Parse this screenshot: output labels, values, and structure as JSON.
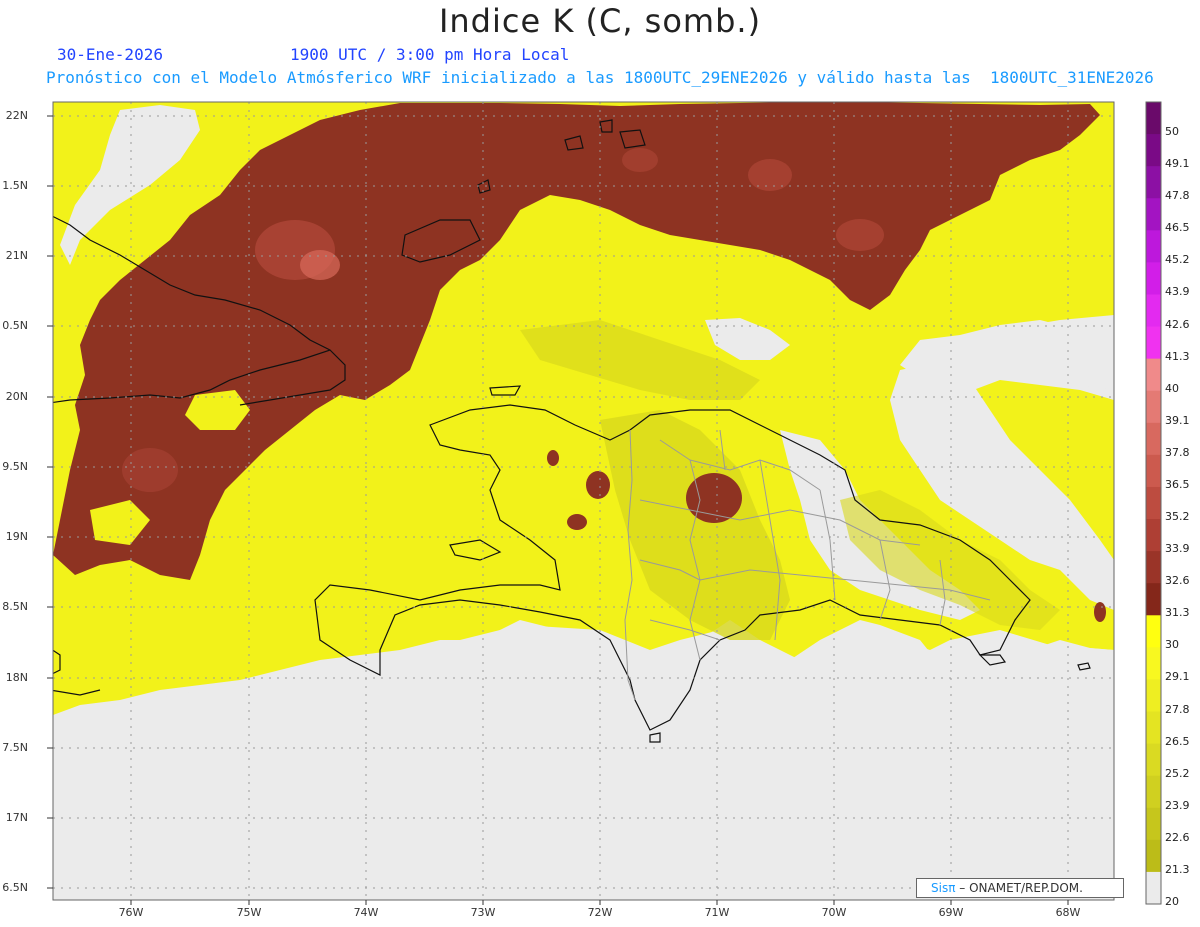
{
  "title": "Indice K (C, somb.)",
  "date": "30-Ene-2026",
  "valid_time": "1900 UTC / 3:00 pm Hora Local",
  "forecast_info": "Pronóstico con el Modelo Atmósferico WRF inicializado a las 1800UTC_29ENE2026 y válido hasta las  1800UTC_31ENE2026",
  "lat_labels": [
    "22N",
    "1.5N",
    "21N",
    "0.5N",
    "20N",
    "9.5N",
    "19N",
    "8.5N",
    "18N",
    "7.5N",
    "17N",
    "6.5N"
  ],
  "lon_labels": [
    "76W",
    "75W",
    "74W",
    "73W",
    "72W",
    "71W",
    "70W",
    "69W",
    "68W"
  ],
  "colorbar": {
    "labels": [
      "50",
      "49.1",
      "47.8",
      "46.5",
      "45.2",
      "43.9",
      "42.6",
      "41.3",
      "40",
      "39.1",
      "37.8",
      "36.5",
      "35.2",
      "33.9",
      "32.6",
      "31.3",
      "30",
      "29.1",
      "27.8",
      "26.5",
      "25.2",
      "23.9",
      "22.6",
      "21.3",
      "20"
    ],
    "colors": [
      "#6a0a6a",
      "#7a0a86",
      "#8c10a4",
      "#a314c2",
      "#bd18dc",
      "#d21ee8",
      "#e32af0",
      "#f032f0",
      "#f08a8a",
      "#e47a74",
      "#d8695f",
      "#cc5a4e",
      "#bd4c40",
      "#ae3f34",
      "#9a3428",
      "#84271a",
      "#ffff10",
      "#f8f820",
      "#eeee22",
      "#e4e422",
      "#dada22",
      "#d0d020",
      "#c6c61c",
      "#bcbc18",
      "#ebebeb"
    ]
  },
  "credit": {
    "brand": "Sisπ",
    "text": "– ONAMET/REP.DOM."
  }
}
